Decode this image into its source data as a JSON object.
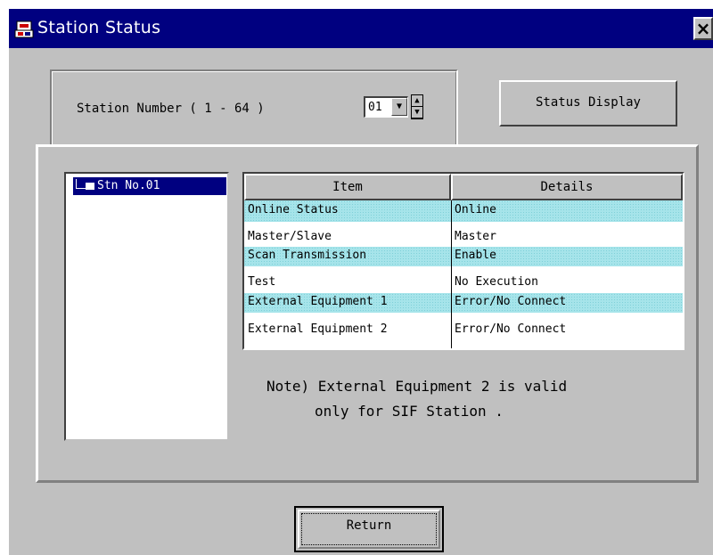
{
  "window": {
    "title": "Station Status",
    "close_glyph": "×"
  },
  "station": {
    "label": "Station Number ( 1 - 64 )",
    "selected": "01",
    "dropdown_glyph": "▼",
    "spin_up_glyph": "▲",
    "spin_down_glyph": "▼"
  },
  "buttons": {
    "status_display": "Status Display",
    "return": "Return"
  },
  "tree": {
    "node_label": "Stn No.01"
  },
  "table": {
    "headers": [
      "Item",
      "Details"
    ],
    "rows": [
      {
        "item": "Online Status",
        "details": "Online"
      },
      {
        "item": "Master/Slave",
        "details": "Master"
      },
      {
        "item": "Scan Transmission",
        "details": "Enable"
      },
      {
        "item": "Test",
        "details": "No Execution"
      },
      {
        "item": "External Equipment 1",
        "details": "Error/No Connect"
      },
      {
        "item": "External Equipment 2",
        "details": "Error/No Connect"
      }
    ]
  },
  "note": {
    "line1": "Note) External Equipment 2 is valid",
    "line2": "only for SIF Station ."
  },
  "colors": {
    "title_bar": "#000080",
    "face": "#c0c0c0",
    "row_highlight": "#a6e4ea",
    "selection": "#000080"
  },
  "icons": {
    "app": "station-status-app-icon",
    "folder": "folder-icon"
  }
}
